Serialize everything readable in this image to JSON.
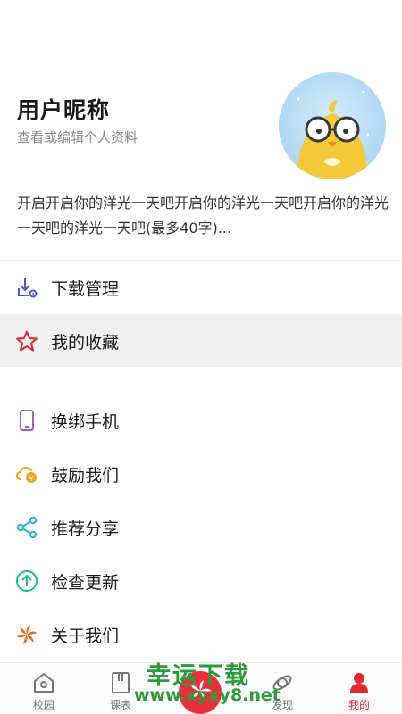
{
  "profile": {
    "username": "用户昵称",
    "subtitle": "查看或编辑个人资料",
    "bio": "开启开启你的洋光一天吧开启你的洋光一天吧开启你的洋光一天吧的洋光一天吧(最多40字)..."
  },
  "menu": {
    "items": [
      {
        "label": "下载管理",
        "icon": "download-settings-icon",
        "color": "#4a57c8"
      },
      {
        "label": "我的收藏",
        "icon": "star-icon",
        "color": "#e0282e"
      },
      {
        "label": "换绑手机",
        "icon": "phone-icon",
        "color": "#a65cc6"
      },
      {
        "label": "鼓励我们",
        "icon": "cloud-coin-icon",
        "color": "#f0a020"
      },
      {
        "label": "推荐分享",
        "icon": "share-icon",
        "color": "#20b8c8"
      },
      {
        "label": "检查更新",
        "icon": "upload-arrow-icon",
        "color": "#20b890"
      },
      {
        "label": "关于我们",
        "icon": "pinwheel-icon",
        "color": "#f06a20"
      }
    ]
  },
  "tabbar": {
    "tabs": [
      {
        "label": "校园",
        "icon": "campus-icon"
      },
      {
        "label": "课表",
        "icon": "schedule-icon"
      },
      {
        "label": "发现",
        "icon": "discover-icon"
      },
      {
        "label": "我的",
        "icon": "profile-icon"
      }
    ],
    "active_color": "#e0282e"
  },
  "watermark": {
    "line1": "幸运下载",
    "line2": "www.xyxy8.net"
  }
}
